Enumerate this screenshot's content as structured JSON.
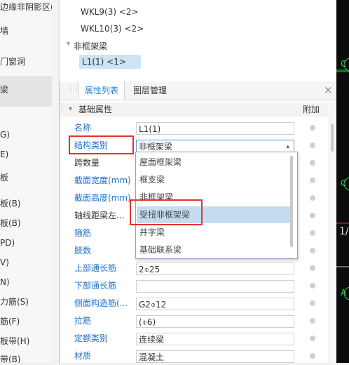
{
  "left_nav": {
    "items": [
      {
        "label": "边缘非阴影区(Z"
      },
      {
        "label": "墙"
      },
      {
        "label": "门窗洞"
      },
      {
        "label": "梁"
      },
      {
        "label": "G)"
      },
      {
        "label": "E)"
      },
      {
        "label": "板"
      },
      {
        "label": "板(B)"
      },
      {
        "label": "板(B)"
      },
      {
        "label": "PD)"
      },
      {
        "label": "V)"
      },
      {
        "label": "N)"
      },
      {
        "label": "力筋(S)"
      },
      {
        "label": "筋(F)"
      },
      {
        "label": "板带(H)"
      },
      {
        "label": "带(B)"
      }
    ]
  },
  "tree": {
    "items": [
      {
        "label": "WKL9(3)  <2>"
      },
      {
        "label": "WKL10(3)  <2>"
      },
      {
        "label": "非框架梁"
      },
      {
        "label": "L1(1)  <1>"
      }
    ],
    "group_toggle": "▾"
  },
  "panel": {
    "drag_handle": "⋮⋮",
    "tabs": [
      {
        "label": "属性列表"
      },
      {
        "label": "图层管理"
      }
    ],
    "close_icon": "×",
    "section_title": "基础属性",
    "section_toggle": "▾",
    "add_header": "附加",
    "rows": [
      {
        "label": "名称",
        "value": "L1(1)"
      },
      {
        "label": "结构类别",
        "value": "非框架梁"
      },
      {
        "label": "跨数量",
        "value": ""
      },
      {
        "label": "截面宽度(mm)",
        "value": ""
      },
      {
        "label": "截面高度(mm)",
        "value": ""
      },
      {
        "label": "轴线距梁左...",
        "value": ""
      },
      {
        "label": "箍筋",
        "value": ""
      },
      {
        "label": "肢数",
        "value": ""
      },
      {
        "label": "上部通长筋",
        "value": "2⌽25"
      },
      {
        "label": "下部通长筋",
        "value": ""
      },
      {
        "label": "侧面构造筋(...",
        "value": "G2⌽12"
      },
      {
        "label": "拉筋",
        "value": "(⌽6)"
      },
      {
        "label": "定额类别",
        "value": "连续梁"
      },
      {
        "label": "材质",
        "value": "混凝土"
      }
    ],
    "select_arrow": "▴"
  },
  "dropdown": {
    "options": [
      {
        "label": "屋面框架梁"
      },
      {
        "label": "框支梁"
      },
      {
        "label": "非框架梁"
      },
      {
        "label": "受扭非框架梁"
      },
      {
        "label": "井字梁"
      },
      {
        "label": "基础联系梁"
      }
    ],
    "highlighted_index": 3
  },
  "canvas_fragments": [
    "C",
    "C",
    "1/",
    "A"
  ],
  "colors": {
    "accent_blue": "#1f6fc6",
    "highlight_red": "#e8312f",
    "selection_blue": "#c5dcf0",
    "canvas_green": "#2fd04a"
  }
}
